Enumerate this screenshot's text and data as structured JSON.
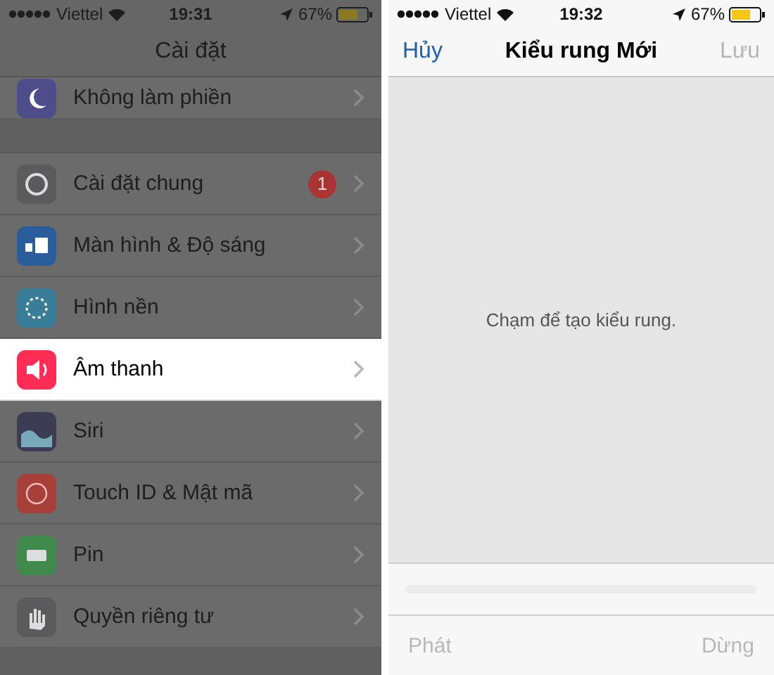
{
  "left_phone": {
    "status_bar": {
      "carrier": "Viettel",
      "time": "19:31",
      "battery": "67%"
    },
    "nav_title": "Cài đặt",
    "partial_row": {
      "label": "Không làm phiền",
      "color": "#4e4c8a"
    },
    "rows": [
      {
        "label": "Cài đặt chung",
        "color": "#5b5b5e",
        "badge": "1",
        "selected": false
      },
      {
        "label": "Màn hình & Độ sáng",
        "color": "#2a5d9c",
        "selected": false
      },
      {
        "label": "Hình nền",
        "color": "#3a7d99",
        "selected": false
      },
      {
        "label": "Âm thanh",
        "color": "#ff2d55",
        "selected": true
      },
      {
        "label": "Siri",
        "color": "#3c3c55",
        "selected": false
      },
      {
        "label": "Touch ID & Mật mã",
        "color": "#a8403a",
        "selected": false
      },
      {
        "label": "Pin",
        "color": "#3f8a4c",
        "selected": false
      },
      {
        "label": "Quyền riêng tư",
        "color": "#5b5b5e",
        "selected": false
      }
    ]
  },
  "right_phone": {
    "status_bar": {
      "carrier": "Viettel",
      "time": "19:32",
      "battery": "67%"
    },
    "cancel": "Hủy",
    "nav_title": "Kiểu rung Mới",
    "save": {
      "label": "Lưu",
      "disabled": true
    },
    "hint": "Chạm để tạo kiểu rung.",
    "play": {
      "label": "Phát",
      "disabled": true
    },
    "stop": {
      "label": "Dừng",
      "disabled": true
    }
  }
}
